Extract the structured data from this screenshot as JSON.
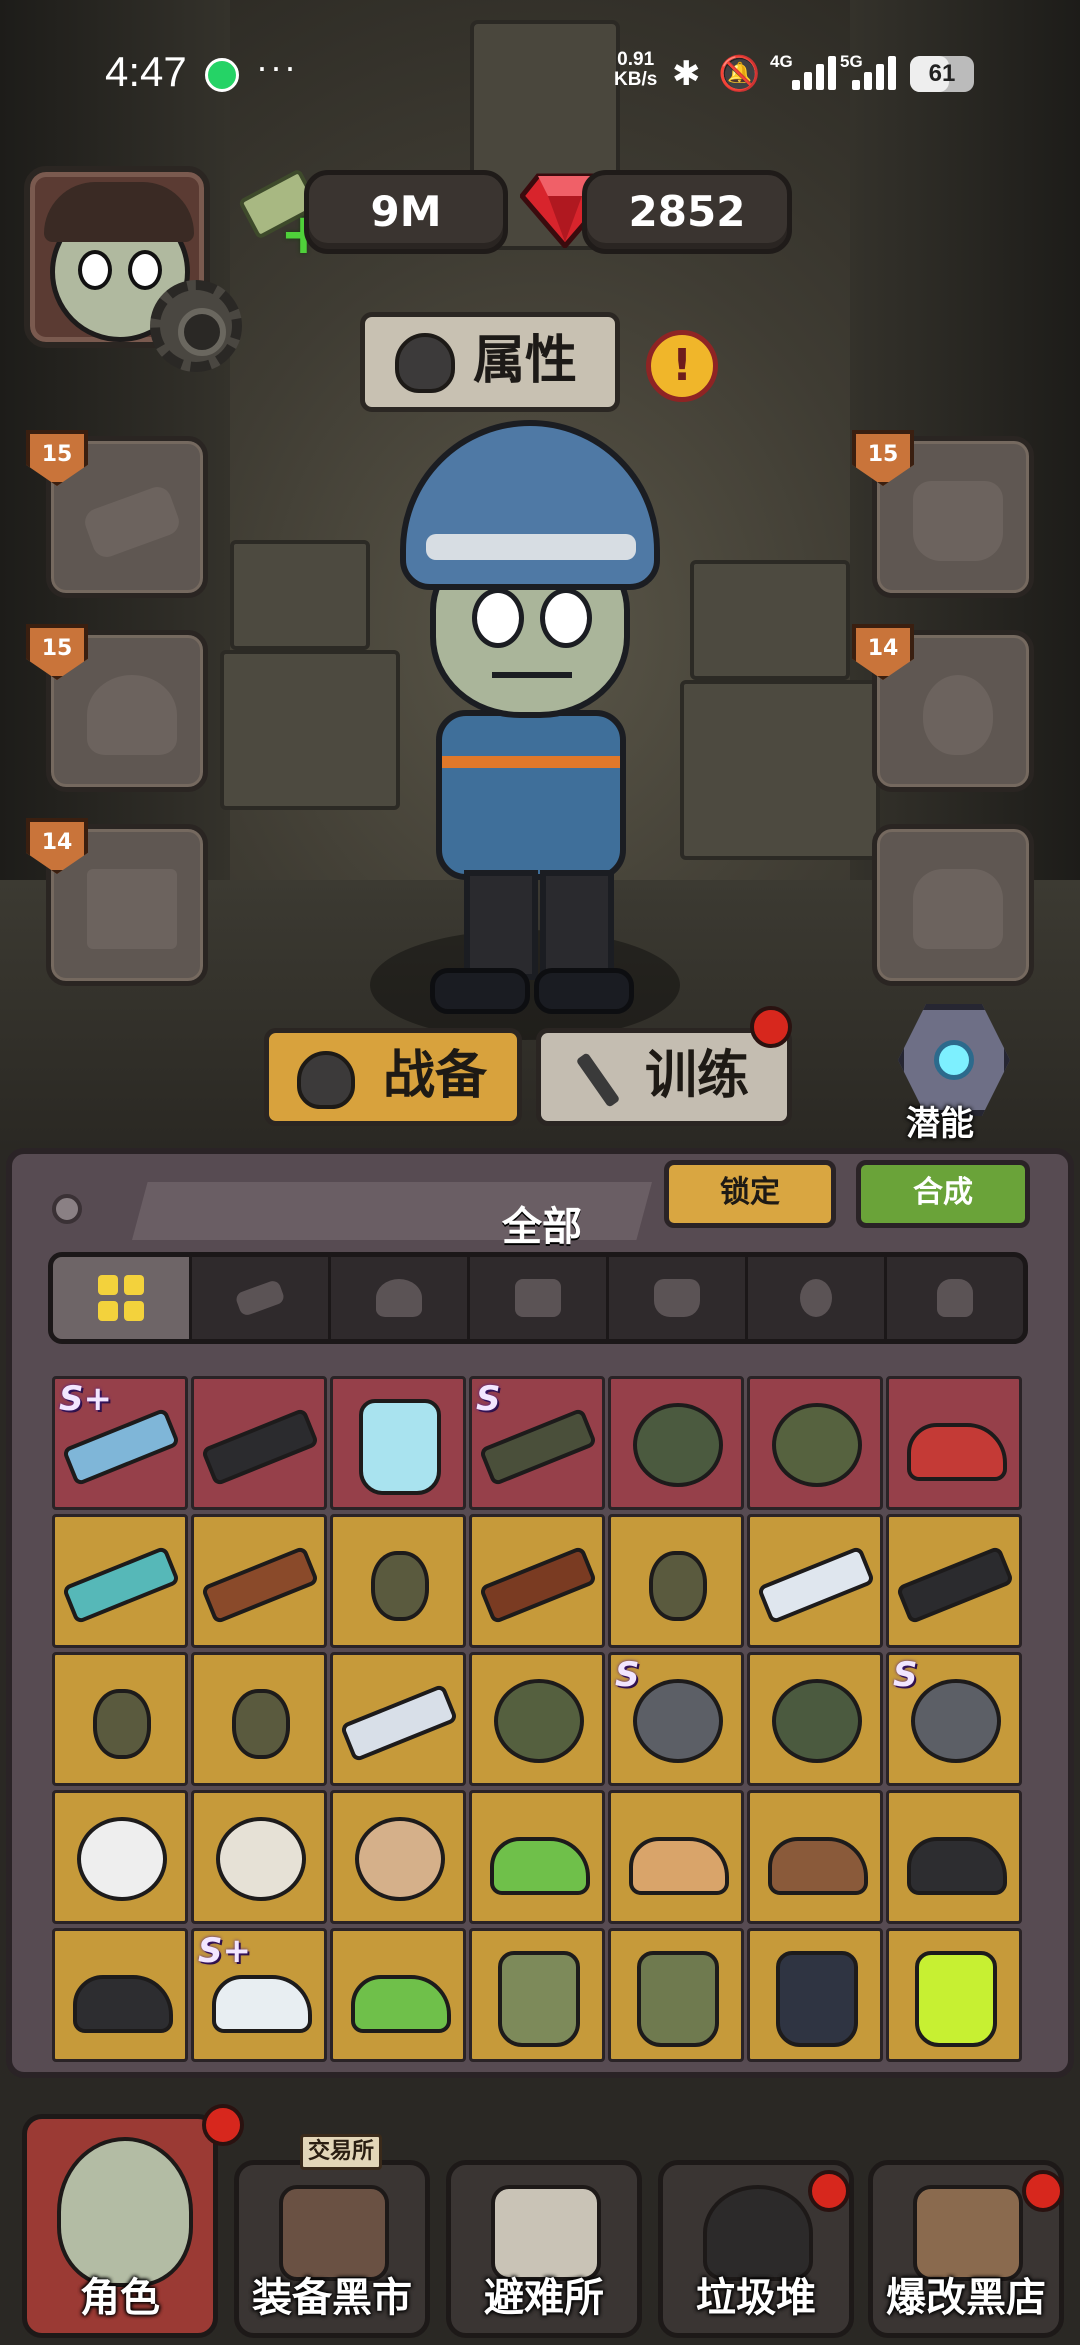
{
  "status_bar": {
    "time": "4:47",
    "more": "···",
    "speed_value": "0.91",
    "speed_unit": "KB/s",
    "net_4g": "4G",
    "net_5g": "5G",
    "battery": "61",
    "battery_level_percent": 61
  },
  "currency": {
    "cash": "9M",
    "gems": "2852"
  },
  "attributes_button": "属性",
  "alert_mark": "!",
  "slots": {
    "left": [
      {
        "name": "weapon",
        "level": "15"
      },
      {
        "name": "helmet",
        "level": "15"
      },
      {
        "name": "pants",
        "level": "14"
      }
    ],
    "right": [
      {
        "name": "armor",
        "level": "15"
      },
      {
        "name": "mask",
        "level": "14"
      },
      {
        "name": "backpack",
        "level": ""
      }
    ]
  },
  "tabs": {
    "equip": "战备",
    "train": "训练",
    "potential": "潜能"
  },
  "inventory": {
    "title": "全部",
    "lock_button": "锁定",
    "craft_button": "合成",
    "filters": [
      "all",
      "weapons",
      "helmets",
      "pants",
      "armor",
      "masks",
      "backpacks"
    ],
    "rows": [
      [
        {
          "rarity": "red",
          "tag": "S+",
          "kind": "long",
          "color": "#7fb6d8"
        },
        {
          "rarity": "red",
          "tag": "",
          "kind": "long",
          "color": "#2b2b2e"
        },
        {
          "rarity": "red",
          "tag": "",
          "kind": "vest",
          "color": "#a9e3ef"
        },
        {
          "rarity": "red",
          "tag": "S",
          "kind": "long",
          "color": "#4a4f3a"
        },
        {
          "rarity": "red",
          "tag": "",
          "kind": "round",
          "color": "#4b5a3f"
        },
        {
          "rarity": "red",
          "tag": "",
          "kind": "round",
          "color": "#56623f"
        },
        {
          "rarity": "red",
          "tag": "",
          "kind": "shoe",
          "color": "#c43a36"
        }
      ],
      [
        {
          "rarity": "gold",
          "tag": "",
          "kind": "long",
          "color": "#56b8b8"
        },
        {
          "rarity": "gold",
          "tag": "",
          "kind": "long",
          "color": "#8a4a2a"
        },
        {
          "rarity": "gold",
          "tag": "",
          "kind": "small",
          "color": "#5a5a3e"
        },
        {
          "rarity": "gold",
          "tag": "",
          "kind": "long",
          "color": "#7a3b22"
        },
        {
          "rarity": "gold",
          "tag": "",
          "kind": "small",
          "color": "#5a5a3e"
        },
        {
          "rarity": "gold",
          "tag": "",
          "kind": "long",
          "color": "#dfe6ee"
        },
        {
          "rarity": "gold",
          "tag": "",
          "kind": "long",
          "color": "#2b2b2e"
        }
      ],
      [
        {
          "rarity": "gold",
          "tag": "",
          "kind": "small",
          "color": "#5a5a3e"
        },
        {
          "rarity": "gold",
          "tag": "",
          "kind": "small",
          "color": "#5a5a3e"
        },
        {
          "rarity": "gold",
          "tag": "",
          "kind": "long",
          "color": "#d8dfe8"
        },
        {
          "rarity": "gold",
          "tag": "",
          "kind": "round",
          "color": "#55603f"
        },
        {
          "rarity": "gold",
          "tag": "S",
          "kind": "round",
          "color": "#5c5f66"
        },
        {
          "rarity": "gold",
          "tag": "",
          "kind": "round",
          "color": "#4b5a3f"
        },
        {
          "rarity": "gold",
          "tag": "S",
          "kind": "round",
          "color": "#5c5f66"
        }
      ],
      [
        {
          "rarity": "gold",
          "tag": "",
          "kind": "round",
          "color": "#eeeeee"
        },
        {
          "rarity": "gold",
          "tag": "",
          "kind": "round",
          "color": "#e6e1d6"
        },
        {
          "rarity": "gold",
          "tag": "",
          "kind": "round",
          "color": "#d5b08a"
        },
        {
          "rarity": "gold",
          "tag": "",
          "kind": "shoe",
          "color": "#6fc04a"
        },
        {
          "rarity": "gold",
          "tag": "",
          "kind": "shoe",
          "color": "#d9a46a"
        },
        {
          "rarity": "gold",
          "tag": "",
          "kind": "shoe",
          "color": "#8a5a3a"
        },
        {
          "rarity": "gold",
          "tag": "",
          "kind": "shoe",
          "color": "#2d2d30"
        }
      ],
      [
        {
          "rarity": "gold",
          "tag": "",
          "kind": "shoe",
          "color": "#2d2d30"
        },
        {
          "rarity": "gold",
          "tag": "S+",
          "kind": "shoe",
          "color": "#e8eef2"
        },
        {
          "rarity": "gold",
          "tag": "",
          "kind": "shoe",
          "color": "#6fc04a"
        },
        {
          "rarity": "gold",
          "tag": "",
          "kind": "vest",
          "color": "#7d8a5a"
        },
        {
          "rarity": "gold",
          "tag": "",
          "kind": "vest",
          "color": "#6f7a4f"
        },
        {
          "rarity": "gold",
          "tag": "",
          "kind": "vest",
          "color": "#2f3442"
        },
        {
          "rarity": "gold",
          "tag": "",
          "kind": "vest",
          "color": "#c7f032"
        }
      ]
    ]
  },
  "nav": {
    "role": "角色",
    "black_market": "装备黑市",
    "trade_tag": "交易所",
    "shelter": "避难所",
    "junk": "垃圾堆",
    "mod_shop": "爆改黑店"
  }
}
